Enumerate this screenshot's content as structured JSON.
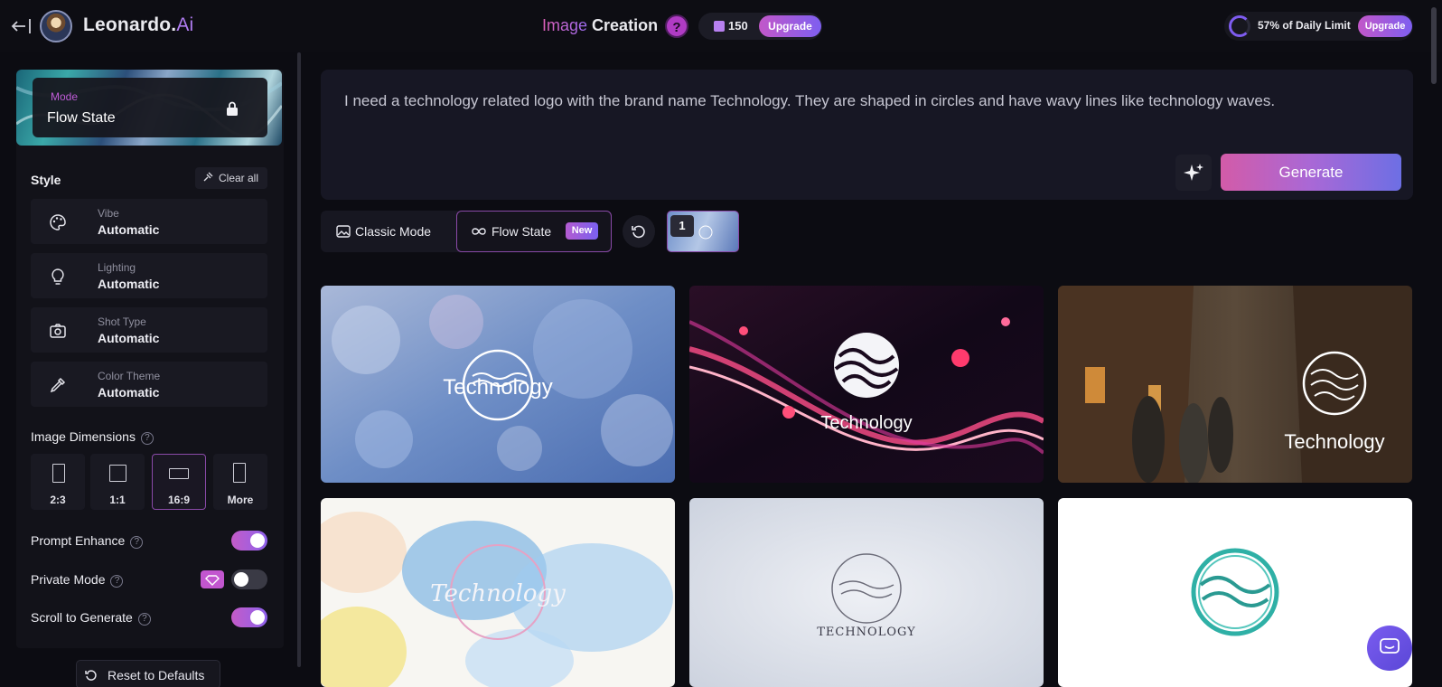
{
  "header": {
    "brand_name": "Leonardo.",
    "brand_suffix": "Ai",
    "title_accent": "Image",
    "title_main": "Creation",
    "help_glyph": "?",
    "token_count": "150",
    "upgrade_label": "Upgrade",
    "daily_limit_text": "57% of Daily Limit",
    "daily_limit_fraction": 0.57,
    "limit_upgrade_label": "Upgrade"
  },
  "sidebar": {
    "mode_label": "Mode",
    "mode_value": "Flow State",
    "style_title": "Style",
    "clear_all_label": "Clear all",
    "style_rows": [
      {
        "label": "Vibe",
        "value": "Automatic",
        "icon": "palette-icon"
      },
      {
        "label": "Lighting",
        "value": "Automatic",
        "icon": "lightbulb-icon"
      },
      {
        "label": "Shot Type",
        "value": "Automatic",
        "icon": "camera-icon"
      },
      {
        "label": "Color Theme",
        "value": "Automatic",
        "icon": "eyedropper-icon"
      }
    ],
    "image_dimensions_title": "Image Dimensions",
    "dimensions": [
      {
        "label": "2:3",
        "selected": false
      },
      {
        "label": "1:1",
        "selected": false
      },
      {
        "label": "16:9",
        "selected": true
      },
      {
        "label": "More",
        "selected": false
      }
    ],
    "toggles": [
      {
        "label": "Prompt Enhance",
        "on": true
      },
      {
        "label": "Private Mode",
        "on": false
      },
      {
        "label": "Scroll to Generate",
        "on": true
      }
    ],
    "reset_label": "Reset to Defaults"
  },
  "prompt": {
    "text": "I need a technology related logo with the brand name Technology. They are shaped in circles and have wavy lines like technology waves.",
    "generate_label": "Generate"
  },
  "mode_switch": {
    "classic_label": "Classic Mode",
    "flow_label": "Flow State",
    "new_badge": "New",
    "thumb_count": "1"
  },
  "images": [
    {
      "logo_text": "Technology"
    },
    {
      "logo_text": "Technology"
    },
    {
      "logo_text": "Technology"
    },
    {
      "logo_text": "Technology"
    },
    {
      "logo_text": "TECHNOLOGY"
    },
    {
      "logo_text": ""
    }
  ],
  "colors": {
    "accent_pink": "#d35ba8",
    "accent_purple": "#7e5ff0",
    "background": "#0c0c12"
  }
}
